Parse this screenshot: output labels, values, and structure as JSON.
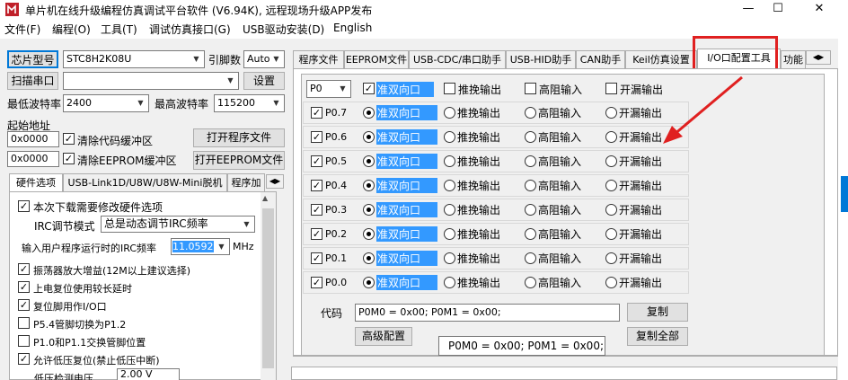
{
  "window": {
    "title": "单片机在线升级编程仿真调试平台软件 (V6.94K), 远程现场升级APP发布",
    "minimize": "—",
    "maximize": "☐",
    "close": "✕"
  },
  "menu": [
    "文件(F)",
    "编程(O)",
    "工具(T)",
    "调试仿真接口(G)",
    "USB驱动安装(D)",
    "English"
  ],
  "left": {
    "chip_model_btn": "芯片型号",
    "chip_model": "STC8H2K08U",
    "pin_count_label": "引脚数",
    "pin_count": "Auto",
    "scan_port_btn": "扫描串口",
    "port_value": "",
    "settings_btn": "设置",
    "min_baud_label": "最低波特率",
    "min_baud": "2400",
    "max_baud_label": "最高波特率",
    "max_baud": "115200",
    "start_addr_label": "起始地址",
    "addr1": "0x0000",
    "clear_code_label": "清除代码缓冲区",
    "open_prog_btn": "打开程序文件",
    "addr2": "0x0000",
    "clear_eeprom_label": "清除EEPROM缓冲区",
    "open_eeprom_btn": "打开EEPROM文件",
    "tabs": [
      "硬件选项",
      "USB-Link1D/U8W/U8W-Mini脱机",
      "程序加"
    ],
    "options": {
      "download_modify": "本次下载需要修改硬件选项",
      "irc_mode_label": "IRC调节模式",
      "irc_mode": "总是动态调节IRC频率",
      "irc_freq_label": "输入用户程序运行时的IRC频率",
      "irc_freq": "11.0592",
      "mhz": "MHz",
      "osc_gain": "振荡器放大增益(12M以上建议选择)",
      "long_reset": "上电复位使用较长延时",
      "reset_io": "复位脚用作I/O口",
      "p54": "P5.4管脚切换为P1.2",
      "p10": "P1.0和P1.1交换管脚位置",
      "lv_reset": "允许低压复位(禁止低压中断)",
      "lv_label": "低压检测电压",
      "lv_value": "2.00 V"
    }
  },
  "right": {
    "tabs": [
      "程序文件",
      "EEPROM文件",
      "USB-CDC/串口助手",
      "USB-HID助手",
      "CAN助手",
      "Keil仿真设置",
      "I/O口配置工具",
      "功能"
    ],
    "port_select": "P0",
    "header_modes": [
      "准双向口",
      "推挽输出",
      "高阻输入",
      "开漏输出"
    ],
    "pins": [
      {
        "name": "P0.7",
        "checked": true,
        "mode": 0
      },
      {
        "name": "P0.6",
        "checked": true,
        "mode": 0
      },
      {
        "name": "P0.5",
        "checked": true,
        "mode": 0
      },
      {
        "name": "P0.4",
        "checked": true,
        "mode": 0
      },
      {
        "name": "P0.3",
        "checked": true,
        "mode": 0
      },
      {
        "name": "P0.2",
        "checked": true,
        "mode": 0
      },
      {
        "name": "P0.1",
        "checked": true,
        "mode": 0
      },
      {
        "name": "P0.0",
        "checked": true,
        "mode": 0
      }
    ],
    "modes": [
      "准双向口",
      "推挽输出",
      "高阻输入",
      "开漏输出"
    ],
    "code_label": "代码",
    "code_value": "P0M0 = 0x00; P0M1 = 0x00;",
    "copy_btn": "复制",
    "advanced_btn": "高级配置",
    "copy_all_btn": "复制全部",
    "tooltip": "P0M0 = 0x00; P0M1 = 0x00;"
  },
  "colors": {
    "highlight": "#e02020",
    "selection": "#3399ff"
  }
}
